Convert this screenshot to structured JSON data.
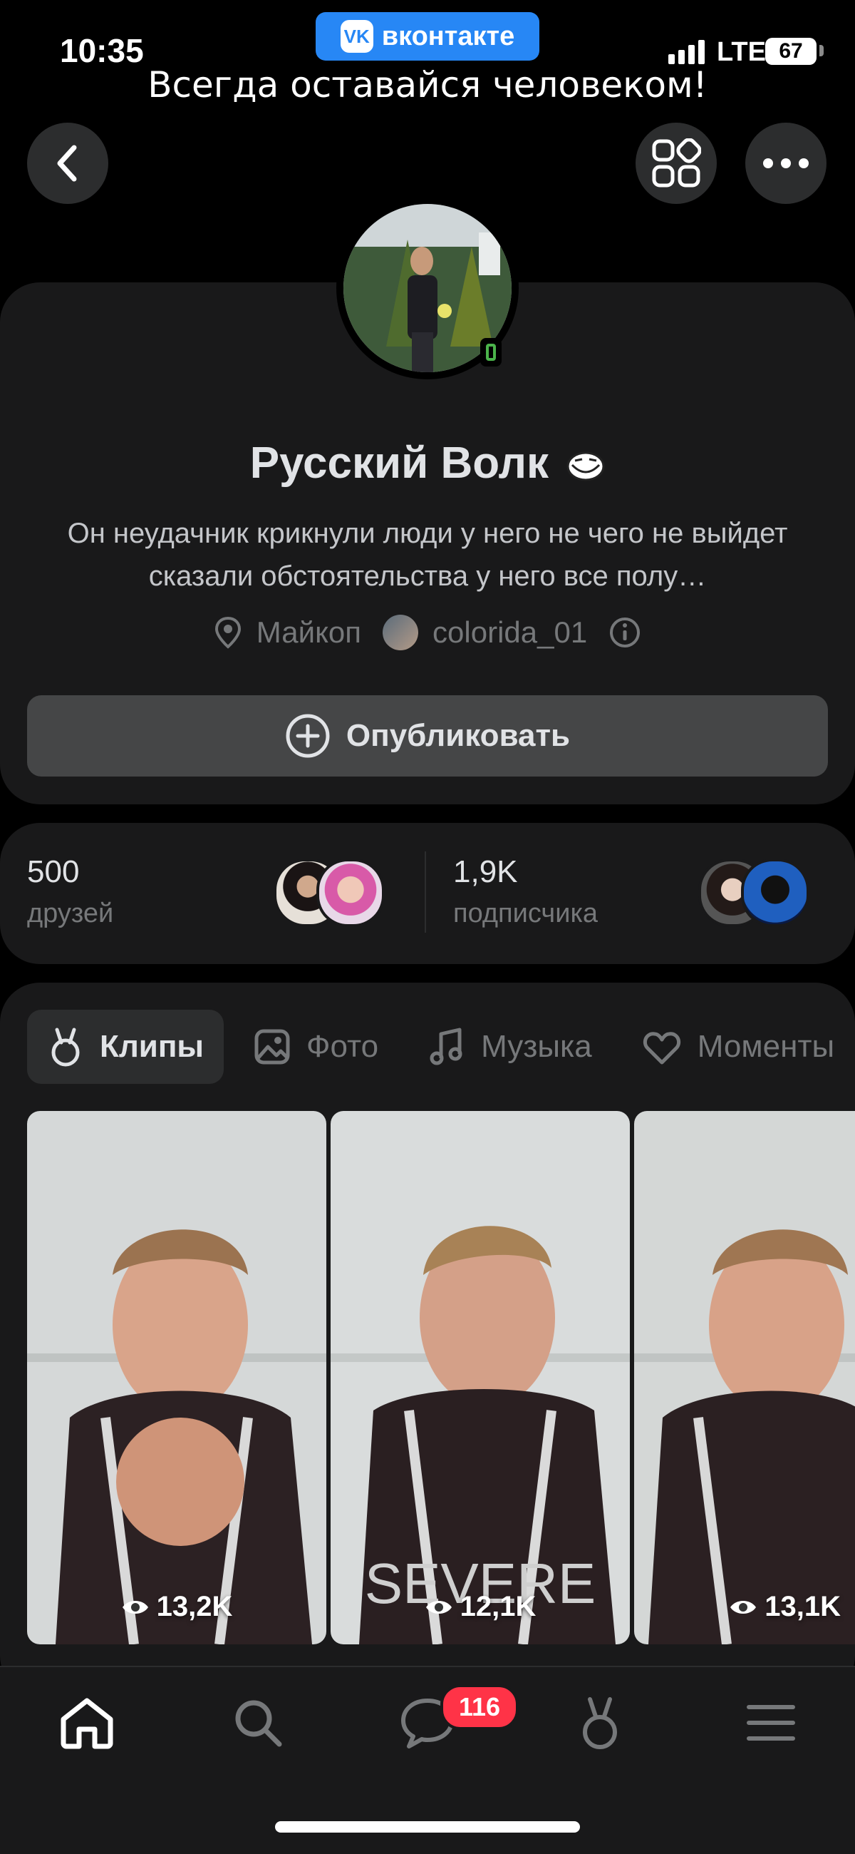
{
  "status_bar": {
    "time": "10:35",
    "app_badge": "вконтакте",
    "network": "LTE",
    "battery": "67",
    "status_text": "Всегда оставайся человеком!"
  },
  "profile": {
    "name": "Русский Волк",
    "status": "Он неудачник крикнули люди у него не чего не выйдет сказали обстоятельства у него все полу…",
    "city": "Майкоп",
    "nickname": "colorida_01",
    "publish_label": "Опубликовать"
  },
  "stats": {
    "friends_count": "500",
    "friends_label": "друзей",
    "subscribers_count": "1,9K",
    "subscribers_label": "подписчика"
  },
  "tabs": [
    {
      "label": "Клипы",
      "icon": "clips-icon",
      "active": true
    },
    {
      "label": "Фото",
      "icon": "photo-icon",
      "active": false
    },
    {
      "label": "Музыка",
      "icon": "music-icon",
      "active": false
    },
    {
      "label": "Моменты",
      "icon": "moments-icon",
      "active": false
    }
  ],
  "clips": [
    {
      "views": "13,2K"
    },
    {
      "views": "12,1K"
    },
    {
      "views": "13,1K"
    }
  ],
  "nav": {
    "messages_badge": "116",
    "items": [
      "home-icon",
      "search-icon",
      "messages-icon",
      "clips-icon",
      "menu-icon"
    ]
  },
  "colors": {
    "background": "#000000",
    "card": "#19191a",
    "accent": "#2787f5",
    "badge": "#ff3347",
    "online": "#4bb34b"
  }
}
